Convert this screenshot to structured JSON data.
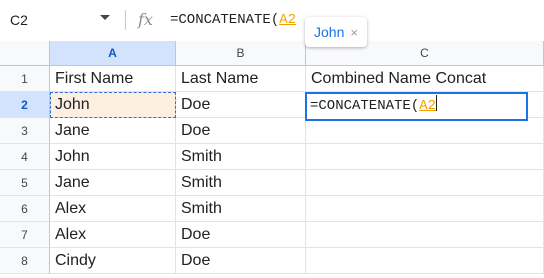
{
  "formula_bar": {
    "name_box": "C2",
    "fx_label": "fx",
    "formula_prefix": "=CONCATENATE(",
    "formula_ref": "A2"
  },
  "columns": [
    "A",
    "B",
    "C"
  ],
  "rows": [
    {
      "num": "1",
      "a": "First Name",
      "b": "Last Name",
      "c": "Combined Name Concat"
    },
    {
      "num": "2",
      "a": "John",
      "b": "Doe",
      "c": ""
    },
    {
      "num": "3",
      "a": "Jane",
      "b": "Doe",
      "c": ""
    },
    {
      "num": "4",
      "a": "John",
      "b": "Smith",
      "c": ""
    },
    {
      "num": "5",
      "a": "Jane",
      "b": "Smith",
      "c": ""
    },
    {
      "num": "6",
      "a": "Alex",
      "b": "Smith",
      "c": ""
    },
    {
      "num": "7",
      "a": "Alex",
      "b": "Doe",
      "c": ""
    },
    {
      "num": "8",
      "a": "Cindy",
      "b": "Doe",
      "c": ""
    }
  ],
  "editor": {
    "formula_prefix": "=CONCATENATE(",
    "formula_ref": "A2"
  },
  "chip": {
    "label": "John",
    "close": "×"
  },
  "colors": {
    "accent": "#1a73e8",
    "selected_header": "#d3e3fd",
    "reference": "#f4a100",
    "reference_fill": "#fdf0e2"
  }
}
